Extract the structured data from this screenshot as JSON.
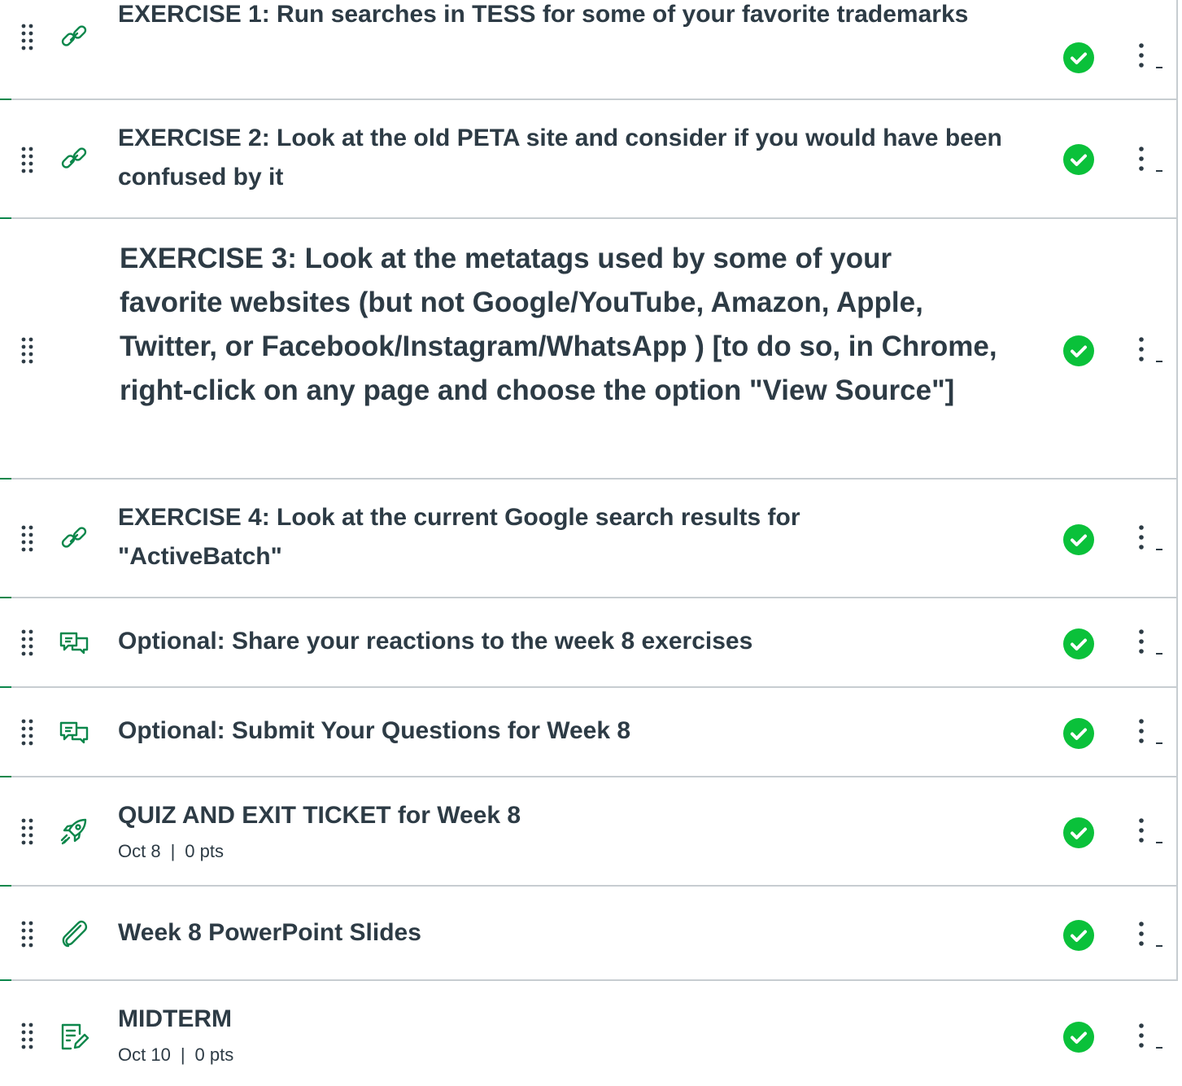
{
  "module_items": [
    {
      "title": "EXERCISE 1: Run searches in TESS for some of your favorite trademarks",
      "type_icon": "link-icon",
      "status": "completed-check-icon",
      "menu": "more-options-icon"
    },
    {
      "title": "EXERCISE 2: Look at the old PETA site and consider if you would have been confused by it",
      "type_icon": "link-icon",
      "status": "completed-check-icon",
      "menu": "more-options-icon"
    },
    {
      "title": "EXERCISE 3: Look at the metatags used by some of your favorite websites (but not Google/YouTube, Amazon, Apple, Twitter, or Facebook/Instagram/WhatsApp ) [to do so, in Chrome, right-click on any page and choose the option \"View Source\"]",
      "type_icon": "none",
      "status": "completed-check-icon",
      "menu": "more-options-icon"
    },
    {
      "title": "EXERCISE 4: Look at the current Google search results for \"ActiveBatch\"",
      "type_icon": "link-icon",
      "status": "completed-check-icon",
      "menu": "more-options-icon"
    },
    {
      "title": "Optional: Share your reactions to the week 8 exercises",
      "type_icon": "discussion-icon",
      "status": "completed-check-icon",
      "menu": "more-options-icon"
    },
    {
      "title": "Optional: Submit Your Questions for Week 8",
      "type_icon": "discussion-icon",
      "status": "completed-check-icon",
      "menu": "more-options-icon"
    },
    {
      "title": "QUIZ AND EXIT TICKET for Week 8",
      "date": "Oct 8",
      "separator": "|",
      "points": "0 pts",
      "type_icon": "quiz-rocket-icon",
      "status": "completed-check-icon",
      "menu": "more-options-icon"
    },
    {
      "title": "Week 8 PowerPoint Slides",
      "type_icon": "attachment-icon",
      "status": "completed-check-icon",
      "menu": "more-options-icon"
    },
    {
      "title": "MIDTERM",
      "date": "Oct 10",
      "separator": "|",
      "points": "0 pts",
      "type_icon": "assignment-icon",
      "status": "completed-check-icon",
      "menu": "more-options-icon"
    }
  ],
  "colors": {
    "text": "#2d3b45",
    "icon_green": "#0b874b",
    "check_green": "#0ac13a",
    "divider": "#c7cdd1"
  }
}
